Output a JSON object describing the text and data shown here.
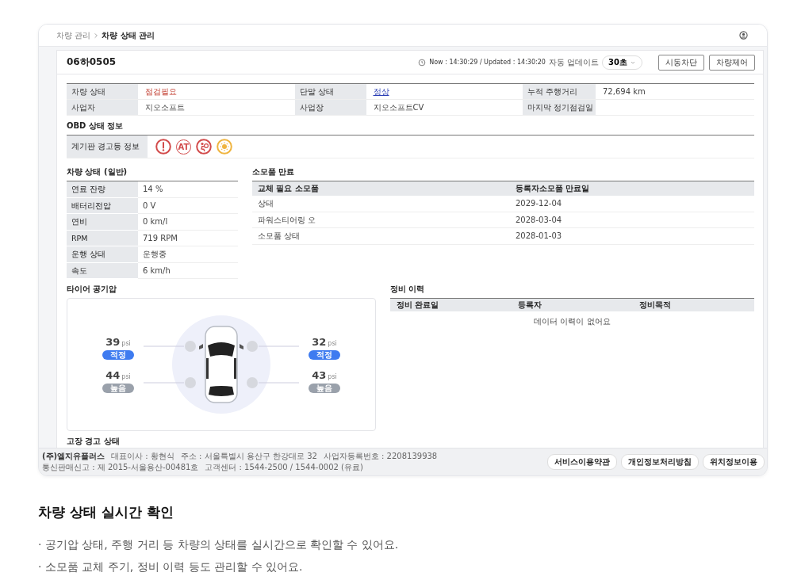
{
  "app": {
    "breadcrumb": [
      "차량 관리",
      "차량 상태 관리"
    ],
    "vehicle_number": "06하0505",
    "update_info": {
      "time_text": "Now : 14:30:29 / Updated : 14:30:20",
      "auto_update_label": "자동 업데이트",
      "interval": "30초"
    },
    "header_buttons": [
      "시동차단",
      "차량제어"
    ],
    "summary": [
      {
        "label": "차량 상태",
        "value": "점검필요",
        "kind": "alert"
      },
      {
        "label": "단말 상태",
        "value": "정상",
        "kind": "link"
      },
      {
        "label": "누적 주행거리",
        "value": "72,694 km",
        "kind": "plain"
      },
      {
        "label": "사업자",
        "value": "지오소프트",
        "kind": "plain"
      },
      {
        "label": "사업장",
        "value": "지오소프트CV",
        "kind": "plain"
      },
      {
        "label": "마지막 정기점검일",
        "kind": "plain"
      }
    ],
    "obd": {
      "title": "OBD 상태 정보",
      "label": "계기판 경고등 정보",
      "warning_lights": [
        {
          "kind": "exclamation",
          "color": "#d24b4b"
        },
        {
          "kind": "text",
          "label": "AT",
          "color": "#d24b4b"
        },
        {
          "kind": "airbag",
          "color": "#d24b4b"
        },
        {
          "kind": "lamp",
          "color": "#efb43f"
        }
      ]
    },
    "general": {
      "title": "차량 상태 (일반)",
      "rows": [
        {
          "label": "연료 잔량",
          "value": "14 %"
        },
        {
          "label": "배터리전압",
          "value": "0 V"
        },
        {
          "label": "연비",
          "value": "0 km/l"
        },
        {
          "label": "RPM",
          "value": "719 RPM"
        },
        {
          "label": "운행 상태",
          "value": "운행중"
        },
        {
          "label": "속도",
          "value": "6 km/h"
        }
      ]
    },
    "consumables": {
      "title": "소모품 만료",
      "columns": [
        "교체 필요 소모품",
        "등록자소모품 만료일"
      ],
      "rows": [
        [
          "상태",
          "2029-12-04"
        ],
        [
          "파워스티어링 오",
          "2028-03-04"
        ],
        [
          "소모품 상태",
          "2028-01-03"
        ]
      ]
    },
    "tire_pressure": {
      "title": "타이어 공기압",
      "left_tires": [
        {
          "value": "39",
          "unit": "psi",
          "status": "적정",
          "kind": "normal"
        },
        {
          "value": "44",
          "unit": "psi",
          "status": "높음",
          "kind": "high"
        }
      ],
      "right_tires": [
        {
          "value": "32",
          "unit": "psi",
          "status": "적정",
          "kind": "normal"
        },
        {
          "value": "43",
          "unit": "psi",
          "status": "높음",
          "kind": "high"
        }
      ]
    },
    "maintenance": {
      "title": "정비 이력",
      "columns": [
        "정비 완료일",
        "등록자",
        "정비목적"
      ],
      "empty_text": "데이터 이력이 없어요"
    },
    "fault_title": "고장 경고 상태",
    "footer": {
      "company": "(주)엘지유플러스",
      "items": [
        "대표이사 : 황현식",
        "주소 : 서울특별시 용산구 한강대로 32",
        "사업자등록번호 : 2208139938",
        "통신판매신고 : 제 2015-서울용산-00481호",
        "고객센터 : 1544-2500 / 1544-0002 (유료)"
      ],
      "links": [
        "서비스이용약관",
        "개인정보처리방침",
        "위치정보이용"
      ]
    }
  },
  "feature": {
    "title": "차량 상태 실시간 확인",
    "bullets": [
      "· 공기압 상태, 주행 거리 등 차량의 상태를 실시간으로 확인할 수 있어요.",
      "· 소모품 교체 주기, 정비 이력 등도 관리할 수 있어요."
    ]
  }
}
